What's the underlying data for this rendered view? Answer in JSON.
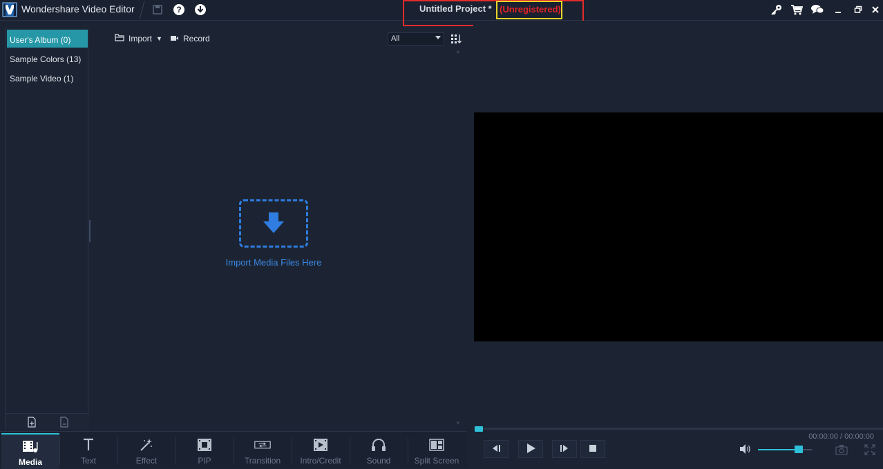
{
  "titlebar": {
    "app_name": "Wondershare Video Editor",
    "project_name": "Untitled Project *",
    "registration_status": "(Unregistered)"
  },
  "album": {
    "items": [
      {
        "label": "User's Album (0)",
        "active": true
      },
      {
        "label": "Sample Colors (13)",
        "active": false
      },
      {
        "label": "Sample Video (1)",
        "active": false
      }
    ]
  },
  "media": {
    "import_label": "Import",
    "record_label": "Record",
    "filter_value": "All",
    "drop_text": "Import Media Files Here"
  },
  "preview": {
    "timecode": "00:00:00 / 00:00:00",
    "volume_level": 0.75
  },
  "tabs": [
    {
      "label": "Media",
      "icon": "media-icon",
      "active": true
    },
    {
      "label": "Text",
      "icon": "text-icon",
      "active": false
    },
    {
      "label": "Effect",
      "icon": "effect-icon",
      "active": false
    },
    {
      "label": "PIP",
      "icon": "pip-icon",
      "active": false
    },
    {
      "label": "Transition",
      "icon": "transition-icon",
      "active": false
    },
    {
      "label": "Intro/Credit",
      "icon": "intro-credit-icon",
      "active": false
    },
    {
      "label": "Sound",
      "icon": "sound-icon",
      "active": false
    },
    {
      "label": "Split Screen",
      "icon": "split-screen-icon",
      "active": false
    }
  ],
  "colors": {
    "accent": "#2ec0d8",
    "active_album": "#2597a6",
    "drop_blue": "#2f7de0",
    "unregistered_red": "#e52424",
    "highlight_yellow": "#e6d52a"
  }
}
